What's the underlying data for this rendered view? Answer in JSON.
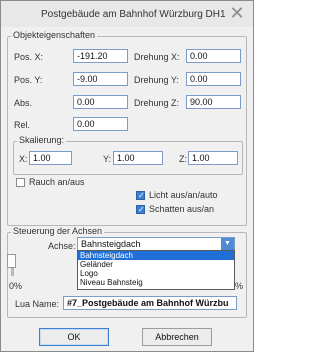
{
  "window": {
    "title": "Postgebäude am Bahnhof Würzburg DH1",
    "close_glyph": "✕"
  },
  "object_props": {
    "legend": "Objekteigenschaften",
    "pos_x": {
      "label": "Pos. X:",
      "value": "-191.20"
    },
    "pos_y": {
      "label": "Pos. Y:",
      "value": "-9.00"
    },
    "abs": {
      "label": "Abs.",
      "value": "0.00"
    },
    "rel": {
      "label": "Rel.",
      "value": "0.00"
    },
    "rot_x": {
      "label": "Drehung X:",
      "value": "0.00"
    },
    "rot_y": {
      "label": "Drehung Y:",
      "value": "0.00"
    },
    "rot_z": {
      "label": "Drehung Z:",
      "value": "90.00"
    },
    "scale": {
      "legend": "Skalierung:",
      "x": {
        "label": "X:",
        "value": "1.00"
      },
      "y": {
        "label": "Y:",
        "value": "1.00"
      },
      "z": {
        "label": "Z:",
        "value": "1.00"
      }
    },
    "smoke": {
      "label": "Rauch an/aus",
      "checked": false
    },
    "light": {
      "label": "Licht aus/an/auto",
      "checked": true
    },
    "shadow": {
      "label": "Schatten aus/an",
      "checked": true
    }
  },
  "axis_control": {
    "legend": "Steuerung der Achsen",
    "axis_label": "Achse:",
    "selected": "Bahnsteigdach",
    "options": [
      "Bahnsteigdach",
      "Geländer",
      "Logo",
      "Niveau Bahnsteig"
    ],
    "slider_percent": "0%",
    "slider_right_char": "%",
    "lua_label": "Lua Name:",
    "lua_value": "#7_Postgebäude am Bahnhof Würzbu"
  },
  "buttons": {
    "ok": "OK",
    "cancel": "Abbrechen"
  },
  "colors": {
    "accent": "#3c7fd1",
    "selection": "#1f6fd6"
  }
}
